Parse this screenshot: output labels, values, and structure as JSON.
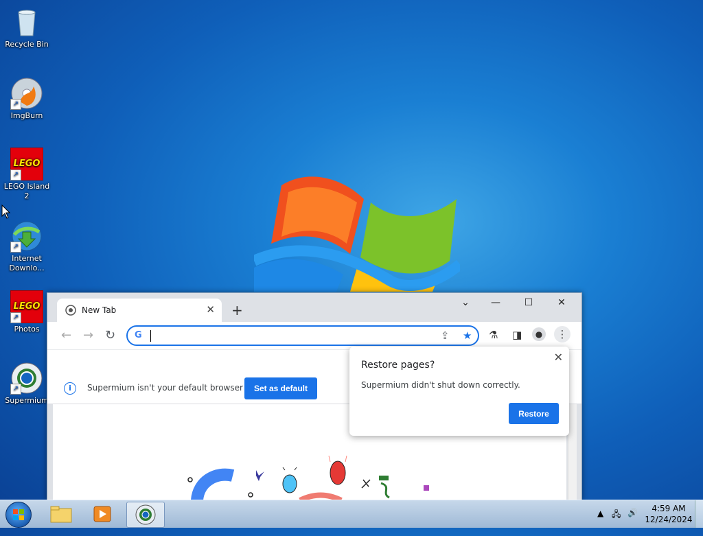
{
  "desktop": {
    "icons": [
      {
        "label": "Recycle Bin",
        "icon": "recycle-bin-icon"
      },
      {
        "label": "ImgBurn",
        "icon": "imgburn-icon"
      },
      {
        "label": "LEGO Island 2",
        "icon": "lego-icon",
        "logo_text": "LEGO"
      },
      {
        "label": "Internet Downlo...",
        "icon": "internet-download-manager-icon"
      },
      {
        "label": "Photos",
        "icon": "lego-icon",
        "logo_text": "LEGO"
      },
      {
        "label": "Supermium",
        "icon": "supermium-icon"
      }
    ]
  },
  "browser": {
    "tab_title": "New Tab",
    "omnibox_value": "",
    "infobar": {
      "message": "Supermium isn't your default browser",
      "button": "Set as default"
    },
    "accent_color": "#1a73e8"
  },
  "restore_popup": {
    "title": "Restore pages?",
    "message": "Supermium didn't shut down correctly.",
    "button": "Restore"
  },
  "taskbar": {
    "time": "4:59 AM",
    "date": "12/24/2024"
  }
}
